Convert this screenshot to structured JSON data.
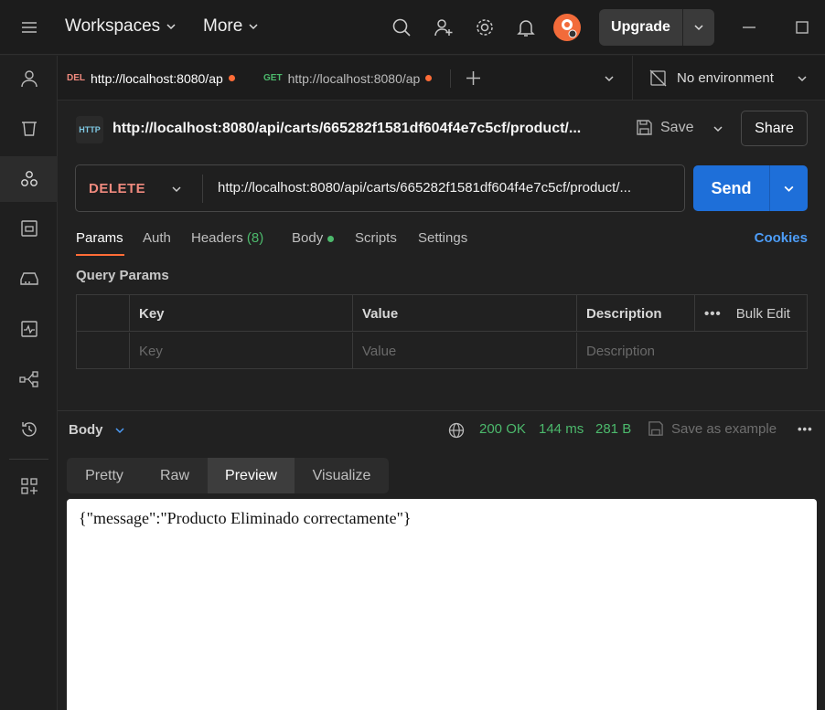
{
  "topbar": {
    "workspaces": "Workspaces",
    "more": "More",
    "upgrade": "Upgrade"
  },
  "tabs": [
    {
      "method": "DEL",
      "url": "http://localhost:8080/ap",
      "method_color": "#f08a7e"
    },
    {
      "method": "GET",
      "url": "http://localhost:8080/ap",
      "method_color": "#4cb96c"
    }
  ],
  "environment": "No environment",
  "request": {
    "title": "http://localhost:8080/api/carts/665282f1581df604f4e7c5cf/product/...",
    "save": "Save",
    "share": "Share",
    "method": "DELETE",
    "url": "http://localhost:8080/api/carts/665282f1581df604f4e7c5cf/product/...",
    "send": "Send"
  },
  "request_tabs": {
    "params": "Params",
    "auth": "Auth",
    "headers": "Headers",
    "headers_count": "(8)",
    "body": "Body",
    "scripts": "Scripts",
    "settings": "Settings",
    "cookies": "Cookies"
  },
  "query_params": {
    "label": "Query Params",
    "headers": {
      "key": "Key",
      "value": "Value",
      "description": "Description",
      "bulk_edit": "Bulk Edit"
    },
    "placeholders": {
      "key": "Key",
      "value": "Value",
      "description": "Description"
    }
  },
  "response": {
    "label": "Body",
    "status": "200 OK",
    "time": "144 ms",
    "size": "281 B",
    "save_example": "Save as example",
    "tabs": [
      "Pretty",
      "Raw",
      "Preview",
      "Visualize"
    ],
    "active_tab": "Preview",
    "preview_text": "{\"message\":\"Producto Eliminado correctamente\"}"
  },
  "colors": {
    "accent": "#ff6c37",
    "send": "#1e6fd9",
    "status_green": "#4cb96c",
    "link_blue": "#4d9df8"
  }
}
